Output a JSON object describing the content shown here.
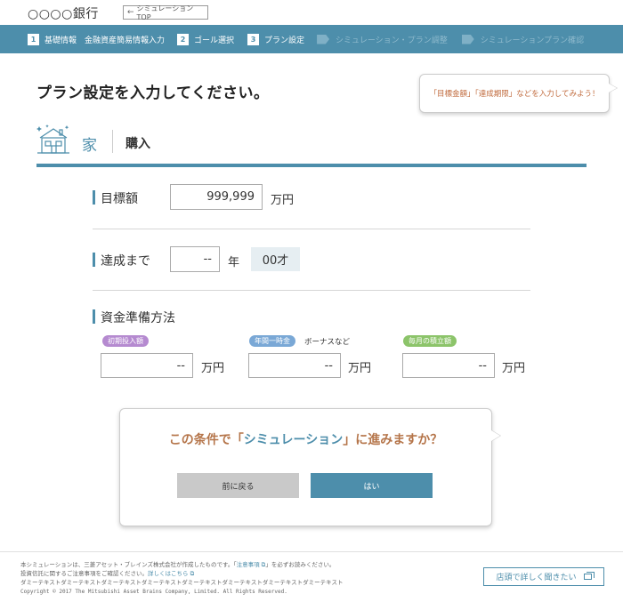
{
  "header": {
    "bank_name": "○○○○銀行",
    "top_button_label": "シミュレーションTOP"
  },
  "steps": [
    {
      "num": "1",
      "label": "基礎情報　金融資産簡易情報入力",
      "state": "done"
    },
    {
      "num": "2",
      "label": "ゴール選択",
      "state": "done"
    },
    {
      "num": "3",
      "label": "プラン設定",
      "state": "current"
    },
    {
      "num": "",
      "label": "シミュレーション・プラン調整",
      "state": "upcoming"
    },
    {
      "num": "",
      "label": "シミュレーションプラン確認",
      "state": "upcoming"
    }
  ],
  "page": {
    "title": "プラン設定を入力してください。",
    "hint": "「目標金額」「達成期限」などを入力してみよう！"
  },
  "category": {
    "icon": "house-icon",
    "name": "家",
    "sub": "購入"
  },
  "target": {
    "label": "目標額",
    "value": "999,999",
    "unit": "万円"
  },
  "deadline": {
    "label": "達成まで",
    "value": "--",
    "unit": "年",
    "age": "00才"
  },
  "funding": {
    "label": "資金準備方法",
    "initial": {
      "tag": "初期投入額",
      "value": "--",
      "unit": "万円",
      "color": "#b58ad0"
    },
    "bonus": {
      "tag": "年間一時金",
      "note": "ボーナスなど",
      "value": "--",
      "unit": "万円",
      "color": "#7aa8d6"
    },
    "monthly": {
      "tag": "毎月の積立額",
      "value": "--",
      "unit": "万円",
      "color": "#8cc46a"
    }
  },
  "dialog": {
    "q_pre": "この条件で「",
    "q_hl": "シミュレーション",
    "q_post": "」に進みますか？",
    "back_label": "前に戻る",
    "yes_label": "はい"
  },
  "footer": {
    "line1_pre": "本シミュレーションは、三菱アセット・ブレインズ株式会社が作成したものです。「",
    "line1_link": "注意事項",
    "line1_post": "」を必ずお読みください。",
    "line2_pre": "投資信託に関するご注意事項をご確認ください。",
    "line2_link": "詳しくはこちら",
    "line3": "ダミーテキストダミーテキストダミーテキストダミーテキストダミーテキストダミーテキストダミーテキストダミーテキスト",
    "copyright": "Copyright © 2017 The Mitsubishi Asset Brains Company, Limited. All Rights Reserved.",
    "shop_button": "店頭で詳しく聞きたい"
  },
  "colors": {
    "accent": "#4d8eab",
    "question": "#b5754a",
    "hint": "#c06a3c"
  }
}
